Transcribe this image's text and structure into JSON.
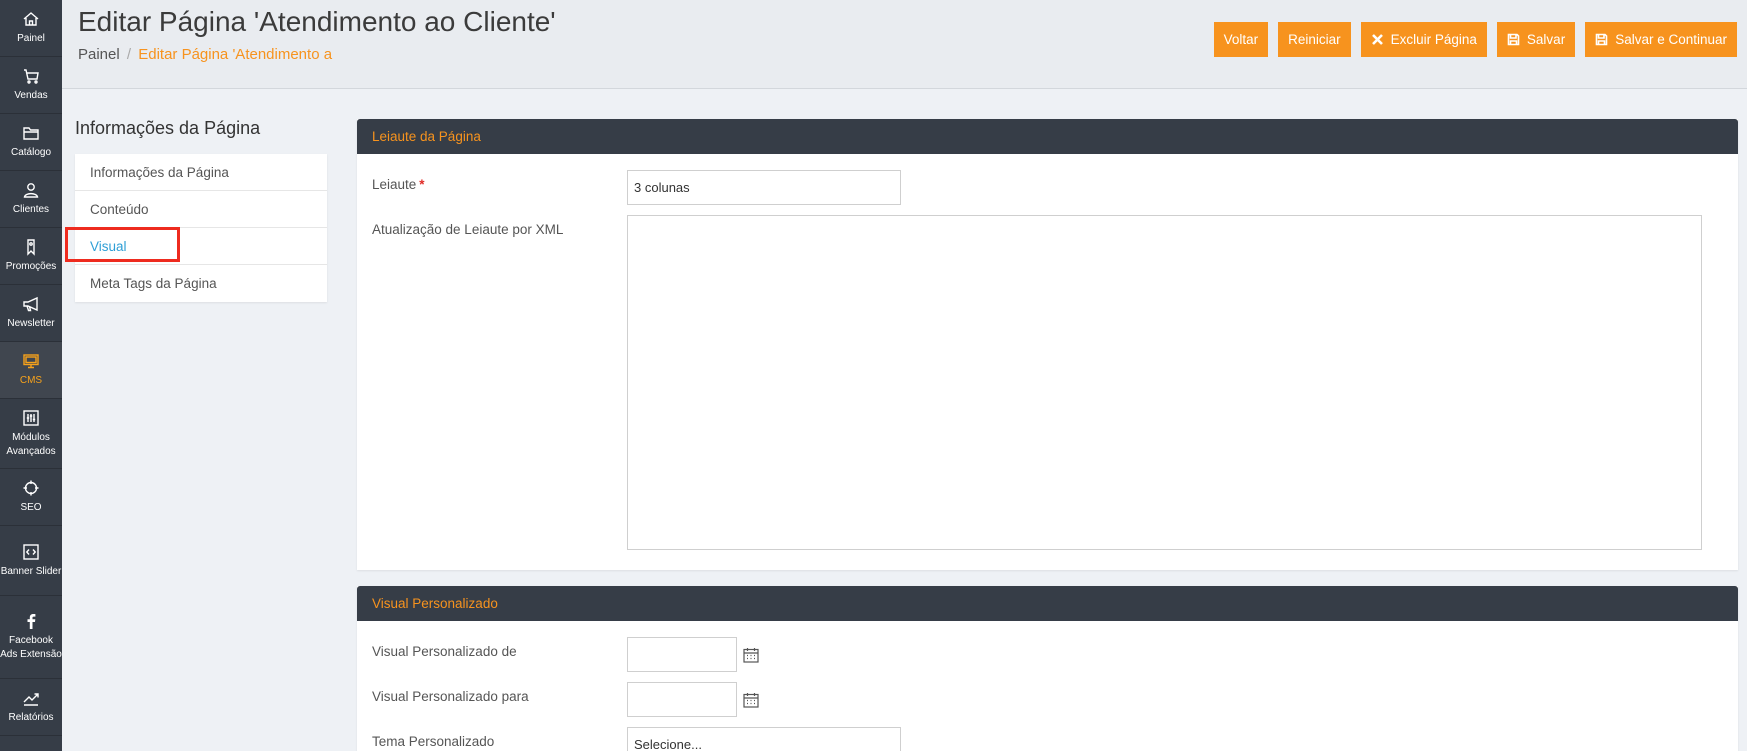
{
  "nav": {
    "items": [
      {
        "label": "Painel",
        "icon": "home-icon"
      },
      {
        "label": "Vendas",
        "icon": "cart-icon"
      },
      {
        "label": "Catálogo",
        "icon": "folder-icon"
      },
      {
        "label": "Clientes",
        "icon": "user-icon"
      },
      {
        "label": "Promoções",
        "icon": "tag-icon"
      },
      {
        "label": "Newsletter",
        "icon": "megaphone-icon"
      },
      {
        "label": "CMS",
        "icon": "monitor-icon",
        "active": true
      },
      {
        "label": "Módulos Avançados",
        "icon": "sliders-icon"
      },
      {
        "label": "SEO",
        "icon": "crosshair-icon"
      },
      {
        "label": "Banner Slider",
        "icon": "code-icon"
      },
      {
        "label": "Facebook Ads Extensão",
        "icon": "facebook-icon"
      },
      {
        "label": "Relatórios",
        "icon": "chart-icon"
      }
    ]
  },
  "header": {
    "title": "Editar Página 'Atendimento ao Cliente'",
    "breadcrumb_root": "Painel",
    "breadcrumb_sep": "/",
    "breadcrumb_current": "Editar Página 'Atendimento a",
    "buttons": {
      "back": "Voltar",
      "reset": "Reiniciar",
      "delete": "Excluir Página",
      "save": "Salvar",
      "save_continue": "Salvar e Continuar"
    }
  },
  "tabs": {
    "title": "Informações da Página",
    "items": [
      "Informações da Página",
      "Conteúdo",
      "Visual",
      "Meta Tags da Página"
    ],
    "active": "Visual"
  },
  "layout_section": {
    "title": "Leiaute da Página",
    "layout_label": "Leiaute",
    "required_mark": "*",
    "layout_value": "3 colunas",
    "xml_label": "Atualização de Leiaute por XML"
  },
  "custom_section": {
    "title": "Visual Personalizado",
    "from_label": "Visual Personalizado de",
    "to_label": "Visual Personalizado para",
    "theme_label": "Tema Personalizado",
    "theme_value": "Selecione..."
  },
  "colors": {
    "accent": "#f7931e",
    "nav_bg": "#363d47",
    "active_tab": "#2f9fd6",
    "annotation": "#ee2b1f"
  }
}
